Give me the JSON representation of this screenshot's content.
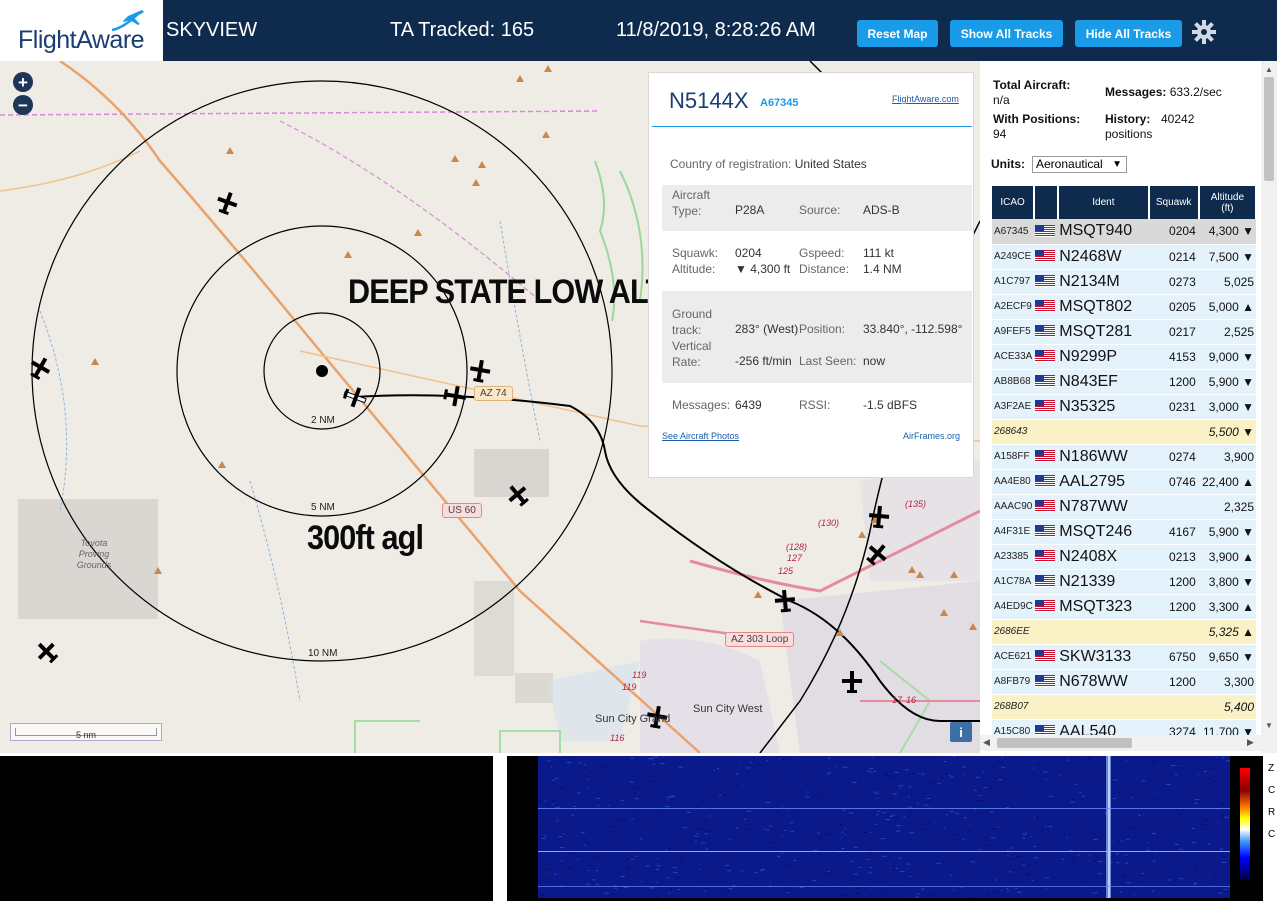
{
  "header": {
    "logo_text": "FlightAware",
    "app_title": "SKYVIEW",
    "tracked": "TA Tracked: 165",
    "datetime": "11/8/2019, 8:28:26 AM",
    "buttons": {
      "reset": "Reset Map",
      "show": "Show All Tracks",
      "hide": "Hide All Tracks"
    },
    "gear_icon": "gear-icon",
    "brand_color": "#0e2a4d",
    "button_color": "#1a9be8"
  },
  "map": {
    "zoom_in": "+",
    "zoom_out": "−",
    "overlay_top": "DEEP STATE LOW ALT",
    "overlay_bottom": "300ft agl",
    "range_labels": {
      "r2": "2 NM",
      "r5": "5 NM",
      "r10": "10 NM"
    },
    "roads": {
      "az74": "AZ 74",
      "us60": "US 60",
      "az303": "AZ 303 Loop"
    },
    "places": {
      "toyota": "Toyota Proving Grounds",
      "sun_city_west": "Sun City West",
      "sun_city_grand": "Sun City Grand"
    },
    "exit_numbers": [
      "(130)",
      "(128)",
      "127",
      "125",
      "(135)",
      "119",
      "119",
      "116",
      "17",
      "16"
    ],
    "scale": "5 nm",
    "info_button": "i"
  },
  "popup": {
    "registration": "N5144X",
    "hex": "A67345",
    "link": "FlightAware.com",
    "country_label": "Country of registration:",
    "country": "United States",
    "type_label": "Aircraft Type:",
    "type": "P28A",
    "source_label": "Source:",
    "source": "ADS-B",
    "squawk_label": "Squawk:",
    "squawk": "0204",
    "gspeed_label": "Gspeed:",
    "gspeed": "111 kt",
    "altitude_label": "Altitude:",
    "altitude": "▼ 4,300 ft",
    "distance_label": "Distance:",
    "distance": "1.4 NM",
    "track_label": "Ground track:",
    "track": "283° (West)",
    "position_label": "Position:",
    "position": "33.840°, -112.598°",
    "vrate_label": "Vertical Rate:",
    "vrate": "-256 ft/min",
    "lastseen_label": "Last Seen:",
    "lastseen": "now",
    "messages_label": "Messages:",
    "messages": "6439",
    "rssi_label": "RSSI:",
    "rssi": "-1.5 dBFS",
    "photos_link": "See Aircraft Photos",
    "airframes_link": "AirFrames.org"
  },
  "panel": {
    "total_label": "Total Aircraft:",
    "total_value": "n/a",
    "messages_label": "Messages:",
    "messages_value": "633.2/sec",
    "withpos_label": "With Positions:",
    "withpos_value": "94",
    "history_label": "History:",
    "history_value": "40242 positions",
    "units_label": "Units:",
    "units_value": "Aeronautical",
    "columns": {
      "icao": "ICAO",
      "ident": "Ident",
      "squawk": "Squawk",
      "altitude": "Altitude (ft)"
    },
    "rows": [
      {
        "icao": "A67345",
        "flag": true,
        "ident": "MSQT940",
        "squawk": "0204",
        "alt": "4,300 ▼",
        "state": "sel"
      },
      {
        "icao": "A249CE",
        "flag": true,
        "ident": "N2468W",
        "squawk": "0214",
        "alt": "7,500 ▼",
        "state": ""
      },
      {
        "icao": "A1C797",
        "flag": true,
        "ident": "N2134M",
        "squawk": "0273",
        "alt": "5,025",
        "state": ""
      },
      {
        "icao": "A2ECF9",
        "flag": true,
        "ident": "MSQT802",
        "squawk": "0205",
        "alt": "5,000 ▲",
        "state": ""
      },
      {
        "icao": "A9FEF5",
        "flag": true,
        "ident": "MSQT281",
        "squawk": "0217",
        "alt": "2,525",
        "state": ""
      },
      {
        "icao": "ACE33A",
        "flag": true,
        "ident": "N9299P",
        "squawk": "4153",
        "alt": "9,000 ▼",
        "state": ""
      },
      {
        "icao": "AB8B68",
        "flag": true,
        "ident": "N843EF",
        "squawk": "1200",
        "alt": "5,900 ▼",
        "state": ""
      },
      {
        "icao": "A3F2AE",
        "flag": true,
        "ident": "N35325",
        "squawk": "0231",
        "alt": "3,000 ▼",
        "state": ""
      },
      {
        "icao": "268643",
        "flag": false,
        "ident": "",
        "squawk": "",
        "alt": "5,500 ▼",
        "state": "noid"
      },
      {
        "icao": "A158FF",
        "flag": true,
        "ident": "N186WW",
        "squawk": "0274",
        "alt": "3,900",
        "state": ""
      },
      {
        "icao": "AA4E80",
        "flag": true,
        "ident": "AAL2795",
        "squawk": "0746",
        "alt": "22,400 ▲",
        "state": ""
      },
      {
        "icao": "AAAC90",
        "flag": true,
        "ident": "N787WW",
        "squawk": "",
        "alt": "2,325",
        "state": ""
      },
      {
        "icao": "A4F31E",
        "flag": true,
        "ident": "MSQT246",
        "squawk": "4167",
        "alt": "5,900 ▼",
        "state": ""
      },
      {
        "icao": "A23385",
        "flag": true,
        "ident": "N2408X",
        "squawk": "0213",
        "alt": "3,900 ▲",
        "state": ""
      },
      {
        "icao": "A1C78A",
        "flag": true,
        "ident": "N21339",
        "squawk": "1200",
        "alt": "3,800 ▼",
        "state": ""
      },
      {
        "icao": "A4ED9C",
        "flag": true,
        "ident": "MSQT323",
        "squawk": "1200",
        "alt": "3,300 ▲",
        "state": ""
      },
      {
        "icao": "2686EE",
        "flag": false,
        "ident": "",
        "squawk": "",
        "alt": "5,325 ▲",
        "state": "noid"
      },
      {
        "icao": "ACE621",
        "flag": true,
        "ident": "SKW3133",
        "squawk": "6750",
        "alt": "9,650 ▼",
        "state": ""
      },
      {
        "icao": "A8FB79",
        "flag": true,
        "ident": "N678WW",
        "squawk": "1200",
        "alt": "3,300",
        "state": ""
      },
      {
        "icao": "268B07",
        "flag": false,
        "ident": "",
        "squawk": "",
        "alt": "5,400",
        "state": "noid"
      },
      {
        "icao": "A15C80",
        "flag": true,
        "ident": "AAL540",
        "squawk": "3274",
        "alt": "11,700 ▼",
        "state": ""
      }
    ]
  },
  "bottom": {
    "waterfall_icon": "spectrum-waterfall",
    "side_labels": [
      "Z",
      "C",
      "R",
      "C"
    ]
  }
}
